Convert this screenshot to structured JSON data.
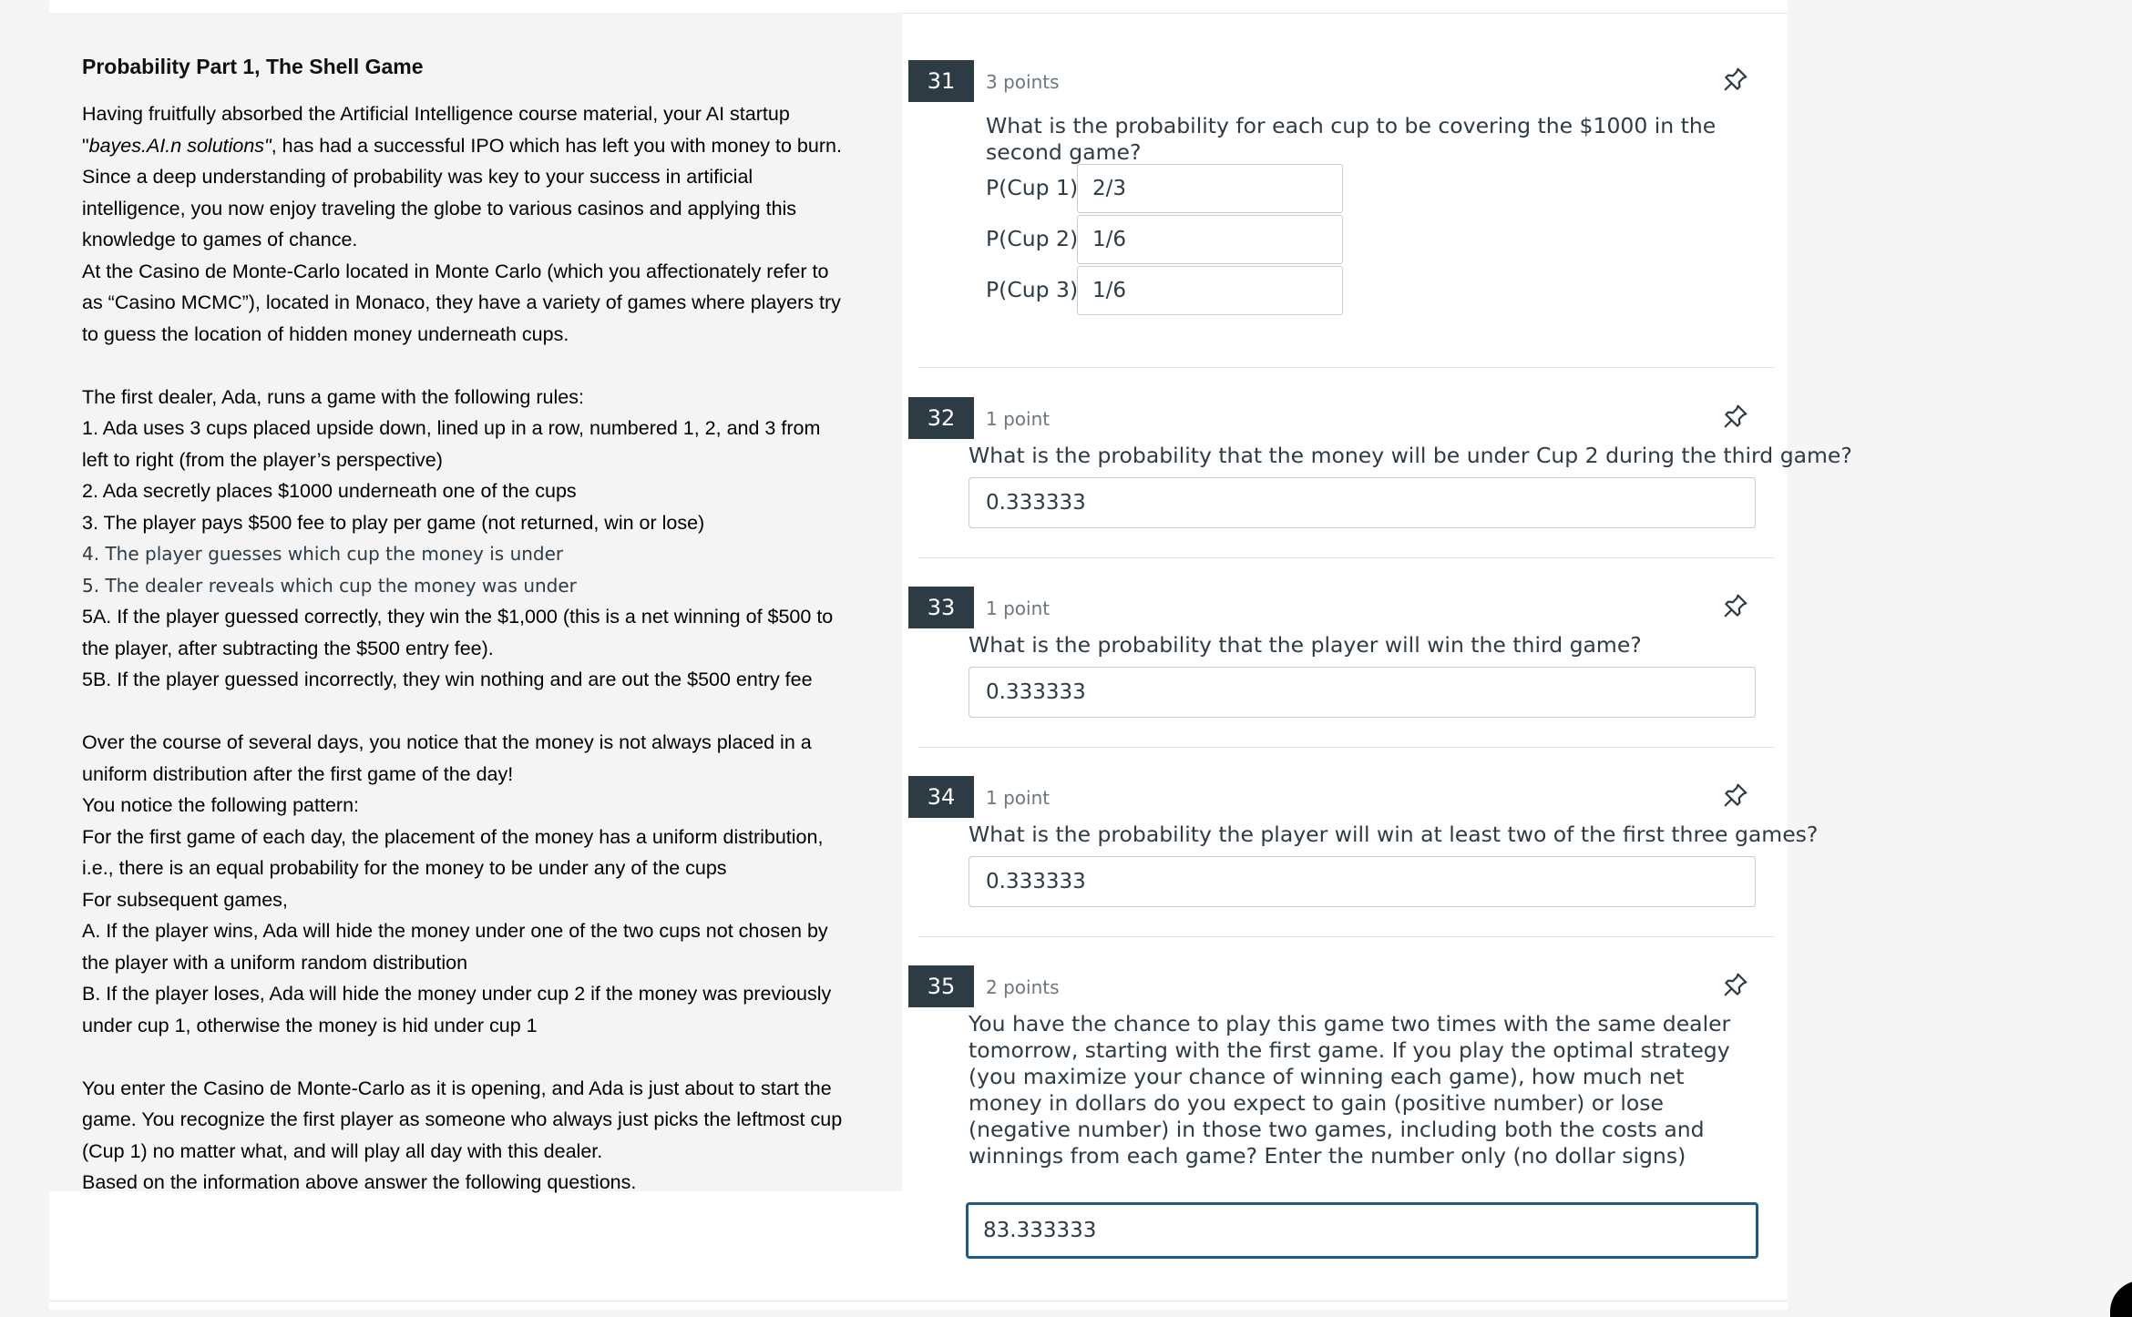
{
  "passage": {
    "title": "Probability Part 1, The Shell Game",
    "intro_pre": "Having fruitfully absorbed the Artificial Intelligence course material, your AI startup",
    "intro_q1": "\"",
    "intro_italic": "bayes.AI.n solutions\"",
    "intro_post": ", has had a successful IPO which has left you with money to burn.",
    "lines_a": [
      "Since a deep understanding of probability was key to your success in artificial",
      "intelligence, you now enjoy traveling the globe to various casinos and applying this",
      "knowledge to games of chance.",
      "At the Casino de Monte-Carlo located in Monte Carlo (which you affectionately refer to",
      "as “Casino MCMC”), located in Monaco, they have a variety of games where players try",
      "to guess the location of hidden money underneath cups."
    ],
    "lines_b": [
      "The first dealer, Ada, runs a game with the following rules:",
      "1. Ada uses 3 cups placed upside down, lined up in a row, numbered 1, 2, and 3 from",
      "left to right (from the player’s perspective)",
      "2. Ada secretly places $1000 underneath one of the cups",
      "3. The player pays $500 fee to play per game (not returned, win or lose)"
    ],
    "lines_c": [
      "4. The player guesses which cup the money is under",
      "5. The dealer reveals which cup the money was under"
    ],
    "lines_d": [
      "5A. If the player guessed correctly, they win the $1,000 (this is a net winning of $500 to",
      "the player, after subtracting the $500 entry fee).",
      "5B. If the player guessed incorrectly, they win nothing and are out the $500 entry fee"
    ],
    "lines_e": [
      "Over the course of several days, you notice that the money is not always placed in a",
      "uniform distribution after the first game of the day!",
      "You notice the following pattern:",
      "For the first game of each day, the placement of the money has a uniform distribution,",
      "i.e., there is an equal probability for the money to be under any of the cups",
      "For subsequent games,",
      "A. If the player wins, Ada will hide the money under one of the two cups not chosen by",
      "the player with a uniform random distribution",
      "B. If the player loses, Ada will hide the money under cup 2 if the money was previously",
      "under cup 1, otherwise the money is hid under cup 1"
    ],
    "lines_f": [
      "You enter the Casino de Monte-Carlo as it is opening, and Ada is just about to start the",
      "game.  You recognize the first player as someone who always just picks the leftmost cup",
      "(Cup 1) no matter what, and will play all day with this dealer.",
      "Based on the information above answer the following questions."
    ]
  },
  "questions": [
    {
      "number": "31",
      "points": "3 points",
      "text": "What is the probability for each cup to be covering the $1000 in the second game?",
      "parts": [
        {
          "label": "P(Cup 1):",
          "value": "2/3"
        },
        {
          "label": "P(Cup 2):",
          "value": "1/6"
        },
        {
          "label": "P(Cup 3):",
          "value": "1/6"
        }
      ]
    },
    {
      "number": "32",
      "points": "1 point",
      "text": "What is the probability that the money will be under Cup 2 during the third game?",
      "answer": "0.333333"
    },
    {
      "number": "33",
      "points": "1 point",
      "text": "What is the probability that the player will win the third game?",
      "answer": "0.333333"
    },
    {
      "number": "34",
      "points": "1 point",
      "text": "What is the probability the player will win at least two of the first three games?",
      "answer": "0.333333"
    },
    {
      "number": "35",
      "points": "2 points",
      "text": "You have the chance to play this game two times with the same dealer tomorrow, starting with the first game. If you play the optimal strategy (you maximize your chance of winning each game), how much net money in dollars do you expect to gain (positive number) or lose (negative number) in those two games, including both the costs and winnings from each game? Enter the number only (no dollar signs)",
      "answer": "83.333333"
    }
  ],
  "icons": {
    "pin": "pin-icon"
  },
  "colors": {
    "question_badge": "#2d3b45",
    "focus_border": "#1e5a87",
    "passage_bg": "#f4f4f4"
  }
}
